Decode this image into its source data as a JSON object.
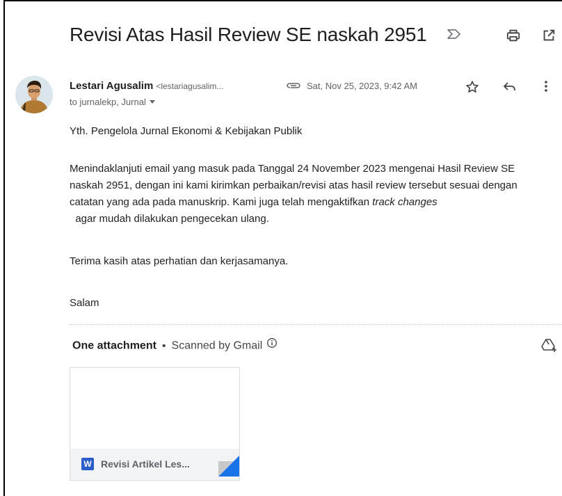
{
  "email": {
    "subject": "Revisi Atas Hasil Review SE naskah 2951",
    "sender_name": "Lestari Agusalim",
    "sender_email": "<lestariagusalim...",
    "date": "Sat, Nov 25, 2023, 9:42 AM",
    "to": "to jurnalekp, Jurnal"
  },
  "body": {
    "greeting": "Yth. Pengelola Jurnal Ekonomi & Kebijakan Publik",
    "main_before": "Menindaklanjuti email yang masuk pada Tanggal 24 November 2023 mengenai Hasil Review SE naskah 2951, dengan ini kami kirimkan perbaikan/revisi atas hasil review tersebut sesuai dengan catatan yang ada pada manuskrip. Kami juga telah mengaktifkan ",
    "main_italic": "track changes",
    "main_after": "  agar mudah dilakukan pengecekan ulang.",
    "thanks": "Terima kasih atas perhatian dan kerjasamanya.",
    "closing": "Salam"
  },
  "attachments": {
    "count_label": "One attachment",
    "separator": "•",
    "scanned_label": "Scanned by Gmail",
    "file_name": "Revisi Artikel Les...",
    "file_type_letter": "W"
  },
  "icons": {
    "important": "important-marker-icon",
    "print": "print-icon",
    "popout": "open-in-new-window-icon",
    "attachment": "paperclip-icon",
    "star": "star-icon",
    "reply": "reply-icon",
    "more": "more-vert-icon",
    "info": "info-icon",
    "drive": "add-to-drive-icon"
  },
  "colors": {
    "word_blue": "#2a5dc9",
    "text_primary": "#1f1f1f",
    "text_secondary": "#5f6368"
  }
}
